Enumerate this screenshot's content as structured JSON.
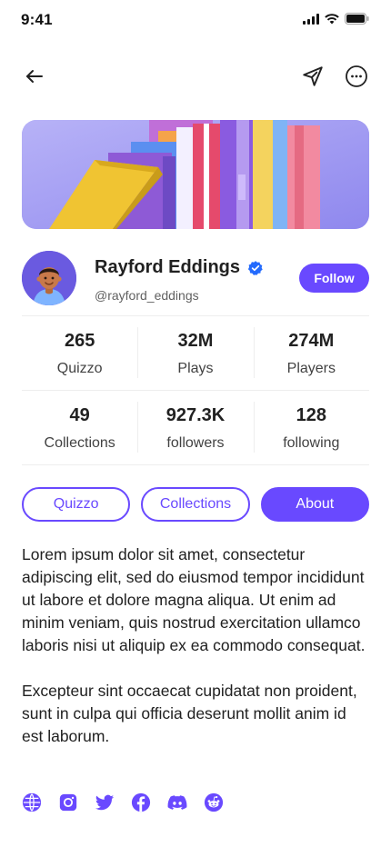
{
  "status_bar": {
    "time": "9:41"
  },
  "header": {
    "back_icon": "arrow-left-icon",
    "send_icon": "send-icon",
    "more_icon": "more-horizontal-icon"
  },
  "profile": {
    "name": "Rayford Eddings",
    "handle": "@rayford_eddings",
    "follow_label": "Follow",
    "verified_icon": "verified-badge-icon"
  },
  "stats_row_1": [
    {
      "value": "265",
      "label": "Quizzo"
    },
    {
      "value": "32M",
      "label": "Plays"
    },
    {
      "value": "274M",
      "label": "Players"
    }
  ],
  "stats_row_2": [
    {
      "value": "49",
      "label": "Collections"
    },
    {
      "value": "927.3K",
      "label": "followers"
    },
    {
      "value": "128",
      "label": "following"
    }
  ],
  "tabs": [
    {
      "label": "Quizzo",
      "active": false
    },
    {
      "label": "Collections",
      "active": false
    },
    {
      "label": "About",
      "active": true
    }
  ],
  "about": {
    "paragraph_1": "Lorem ipsum dolor sit amet, consectetur adipiscing elit, sed do eiusmod tempor incididunt ut labore et dolore magna aliqua. Ut enim ad minim veniam, quis nostrud exercitation ullamco laboris nisi ut aliquip ex ea commodo consequat.",
    "paragraph_2": "Excepteur sint occaecat cupidatat non proident, sunt in culpa qui officia deserunt mollit anim id est laborum."
  },
  "socials": [
    "globe-icon",
    "instagram-icon",
    "twitter-icon",
    "facebook-icon",
    "discord-icon",
    "reddit-icon"
  ],
  "colors": {
    "primary": "#6949ff",
    "verified": "#246bfd",
    "text": "#212121",
    "divider": "#eeeeee"
  }
}
